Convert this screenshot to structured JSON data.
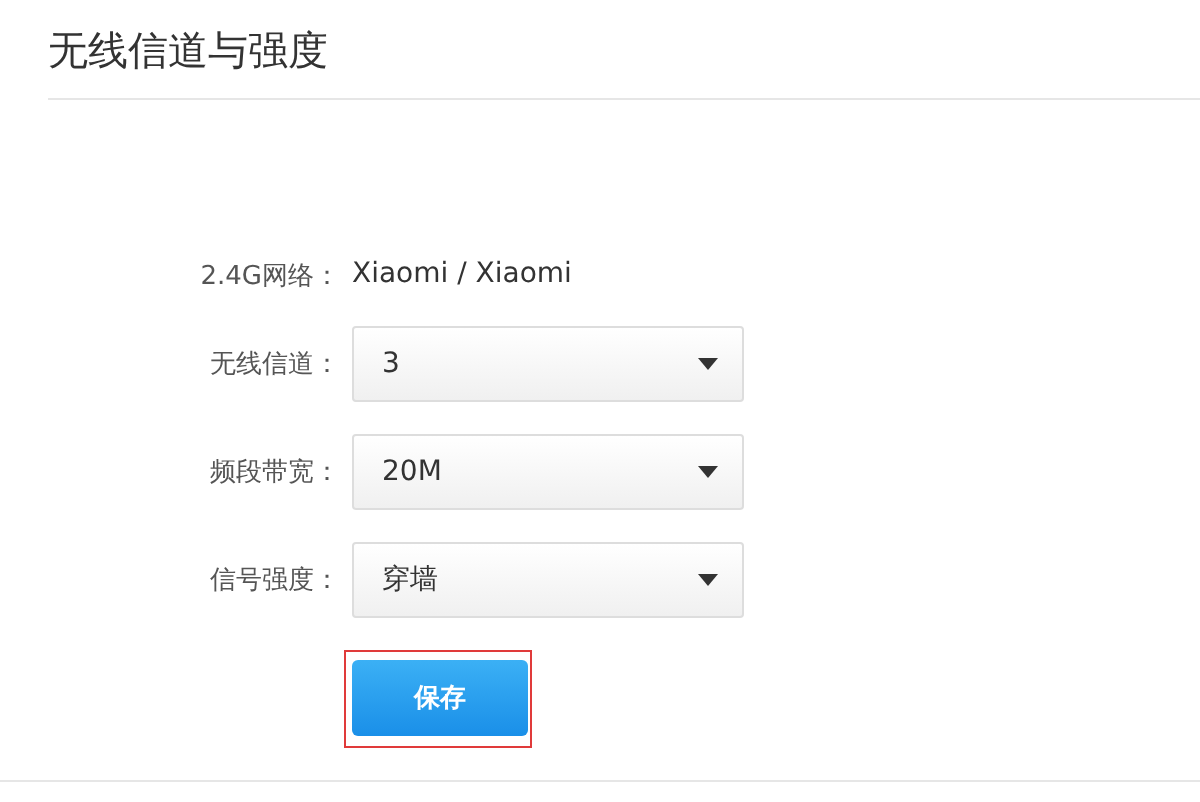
{
  "page": {
    "title": "无线信道与强度"
  },
  "network": {
    "label": "2.4G网络：",
    "value": "Xiaomi / Xiaomi"
  },
  "fields": [
    {
      "label": "无线信道：",
      "value": "3"
    },
    {
      "label": "频段带宽：",
      "value": "20M"
    },
    {
      "label": "信号强度：",
      "value": "穿墙"
    }
  ],
  "save_button": {
    "label": "保存",
    "highlighted": true
  }
}
